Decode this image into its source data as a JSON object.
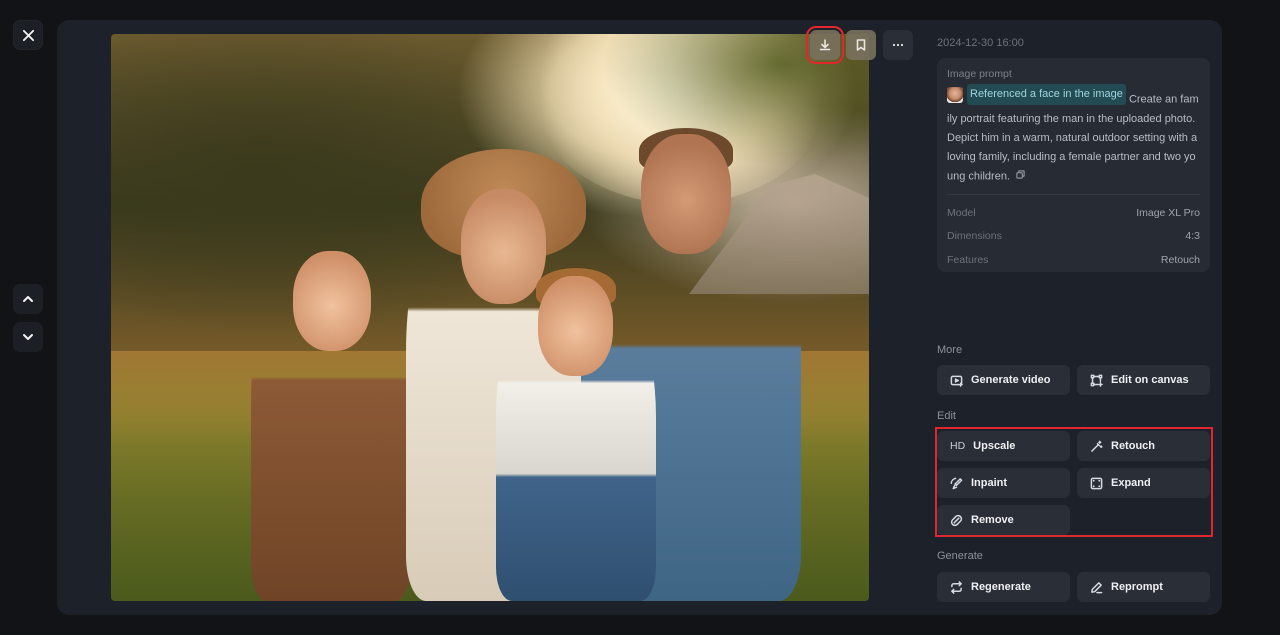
{
  "nav": {
    "close_icon": "close-icon",
    "prev_icon": "chevron-up-icon",
    "next_icon": "chevron-down-icon"
  },
  "image": {
    "alt": "Family portrait: man, woman in a straw hat, a girl and a boy sitting in sunlit grass",
    "tools": [
      {
        "name": "download",
        "icon": "download-icon",
        "highlighted": true
      },
      {
        "name": "bookmark",
        "icon": "bookmark-icon"
      },
      {
        "name": "more",
        "icon": "more-horizontal-icon"
      }
    ]
  },
  "details": {
    "timestamp": "2024-12-30 16:00",
    "prompt_label": "Image prompt",
    "reference_chip": "Referenced a face in the image",
    "prompt_text": "Create an family portrait featuring the man in the uploaded photo. Depict him in a warm, natural outdoor setting with a loving family, including a female partner and two young children.",
    "meta": [
      {
        "key": "Model",
        "value": "Image XL Pro"
      },
      {
        "key": "Dimensions",
        "value": "4:3"
      },
      {
        "key": "Features",
        "value": "Retouch"
      }
    ]
  },
  "sections": {
    "more": {
      "label": "More",
      "buttons": [
        {
          "label": "Generate video",
          "icon": "video-plus-icon"
        },
        {
          "label": "Edit on canvas",
          "icon": "canvas-icon"
        }
      ]
    },
    "edit": {
      "label": "Edit",
      "buttons": [
        {
          "label": "Upscale",
          "icon_text": "HD"
        },
        {
          "label": "Retouch",
          "icon": "magic-wand-icon"
        },
        {
          "label": "Inpaint",
          "icon": "inpaint-brush-icon"
        },
        {
          "label": "Expand",
          "icon": "expand-icon"
        },
        {
          "label": "Remove",
          "icon": "eraser-icon"
        }
      ]
    },
    "generate": {
      "label": "Generate",
      "buttons": [
        {
          "label": "Regenerate",
          "icon": "regenerate-icon"
        },
        {
          "label": "Reprompt",
          "icon": "pencil-icon"
        }
      ]
    }
  },
  "colors": {
    "background": "#111317",
    "panel": "#1d2129",
    "card": "#272b34",
    "button": "#2a2e37",
    "highlight_outline": "#e3262e",
    "reference_chip_bg": "#234b53"
  }
}
